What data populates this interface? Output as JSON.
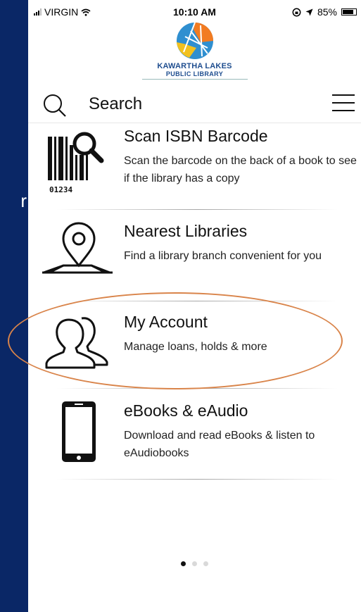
{
  "side_text": "r",
  "status_bar": {
    "carrier": "VIRGIN",
    "time": "10:10 AM",
    "battery": "85%"
  },
  "logo": {
    "line1": "KAWARTHA LAKES",
    "line2": "PUBLIC LIBRARY"
  },
  "search": {
    "label": "Search"
  },
  "menu_items": [
    {
      "title": "Scan ISBN Barcode",
      "description": "Scan the barcode on the back of a book to see if the library has a copy",
      "barcode_digits": "01234"
    },
    {
      "title": "Nearest Libraries",
      "description": "Find a library branch convenient for you"
    },
    {
      "title": "My Account",
      "description": "Manage loans, holds & more"
    },
    {
      "title": "eBooks & eAudio",
      "description": "Download and read eBooks & listen to eAudiobooks"
    }
  ],
  "pagination": {
    "pages": 3,
    "current": 1
  },
  "colors": {
    "background": "#0a2766",
    "highlight": "#d9844a",
    "logo_text": "#1e4d8f"
  }
}
